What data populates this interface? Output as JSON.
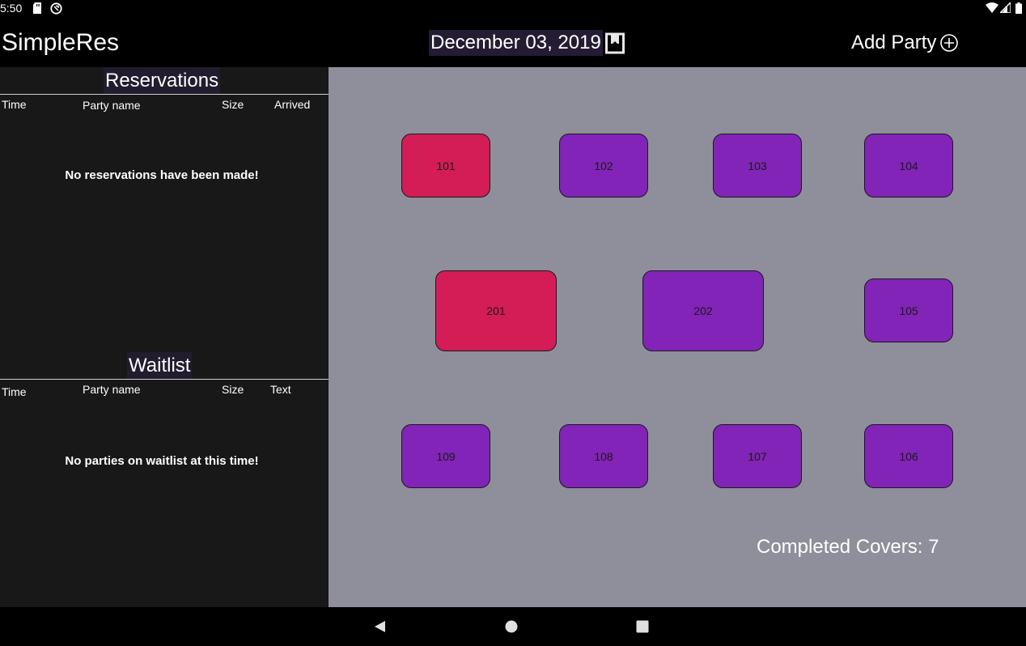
{
  "status_bar": {
    "time": "5:50"
  },
  "app_bar": {
    "title": "SimpleRes",
    "date": "December 03, 2019",
    "add_party_label": "Add Party"
  },
  "reservations": {
    "title": "Reservations",
    "columns": [
      "Time",
      "Party name",
      "Size",
      "Arrived"
    ],
    "empty_message": "No reservations have been made!"
  },
  "waitlist": {
    "title": "Waitlist",
    "columns": [
      "Time",
      "Party name",
      "Size",
      "Text"
    ],
    "empty_message": "No parties on waitlist at this time!"
  },
  "floor": {
    "tables": [
      {
        "number": "101",
        "status": "occupied"
      },
      {
        "number": "102",
        "status": "available"
      },
      {
        "number": "103",
        "status": "available"
      },
      {
        "number": "104",
        "status": "available"
      },
      {
        "number": "201",
        "status": "occupied"
      },
      {
        "number": "202",
        "status": "available"
      },
      {
        "number": "105",
        "status": "available"
      },
      {
        "number": "109",
        "status": "available"
      },
      {
        "number": "108",
        "status": "available"
      },
      {
        "number": "107",
        "status": "available"
      },
      {
        "number": "106",
        "status": "available"
      }
    ],
    "completed_covers_label": "Completed Covers: 7"
  },
  "colors": {
    "occupied": "#d41c57",
    "available": "#8124b7",
    "floor_bg": "#8f8f9b"
  }
}
